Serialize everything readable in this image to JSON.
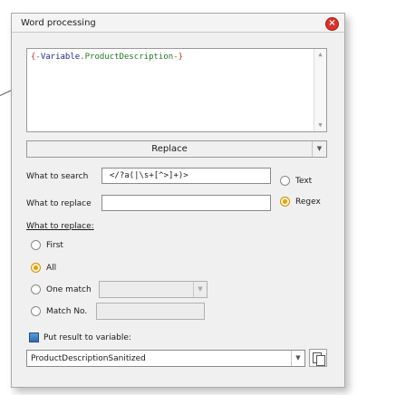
{
  "window": {
    "title": "Word processing"
  },
  "source": {
    "brace_open": "{-",
    "variable": "Variable",
    "dot": ".",
    "property": "ProductDescription",
    "brace_close": "-}"
  },
  "action": {
    "selected": "Replace"
  },
  "search": {
    "label": "What to search",
    "value": "</?a(|\\s+[^>]+)>",
    "option_text": "Text",
    "option_regex": "Regex",
    "selected_option": "Regex"
  },
  "replace": {
    "label": "What to replace",
    "value": ""
  },
  "scope": {
    "heading": "What to replace:",
    "options": [
      "First",
      "All",
      "One match",
      "Match No."
    ],
    "selected": "All",
    "one_match_value": "",
    "match_no_value": ""
  },
  "result": {
    "checkbox_label": "Put result to variable:",
    "variable": "ProductDescriptionSanitized"
  },
  "colors": {
    "close": "#d9342b",
    "radio_on": "#e5a100",
    "checkbox": "#2e6db5"
  }
}
